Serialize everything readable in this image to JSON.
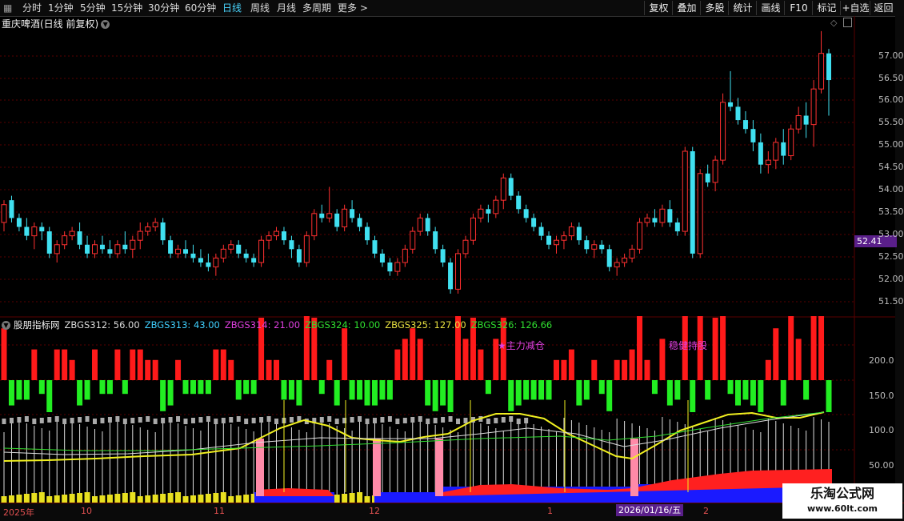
{
  "menubar": {
    "periods": [
      {
        "label": "分时"
      },
      {
        "label": "1分钟"
      },
      {
        "label": "5分钟"
      },
      {
        "label": "15分钟"
      },
      {
        "label": "30分钟"
      },
      {
        "label": "60分钟"
      },
      {
        "label": "日线",
        "active": true
      },
      {
        "label": "周线"
      },
      {
        "label": "月线"
      },
      {
        "label": "多周期"
      },
      {
        "label": "更多 >"
      }
    ],
    "buttons": [
      {
        "label": "复权"
      },
      {
        "label": "叠加"
      },
      {
        "label": "多股"
      },
      {
        "label": "统计"
      },
      {
        "label": "画线"
      },
      {
        "label": "F10"
      },
      {
        "label": "标记"
      },
      {
        "label": "+自选"
      },
      {
        "label": "返回"
      }
    ]
  },
  "chart": {
    "title": "重庆啤酒(日线 前复权)",
    "price_ticks": [
      "57.00",
      "56.50",
      "56.00",
      "55.50",
      "55.00",
      "54.50",
      "54.00",
      "53.50",
      "53.00",
      "52.50",
      "52.00",
      "51.50"
    ],
    "current_price": "52.41"
  },
  "indicator": {
    "name": "股朋指标网",
    "values": [
      {
        "text": "ZBGS312: 56.00",
        "color": "#dddddd"
      },
      {
        "text": "ZBGS313: 43.00",
        "color": "#40d0ff"
      },
      {
        "text": "ZBGS314: 21.00",
        "color": "#e040e0"
      },
      {
        "text": "ZBGS324: 10.00",
        "color": "#30e030"
      },
      {
        "text": "ZBGS325: 127.00",
        "color": "#e8e040"
      },
      {
        "text": "ZBGS326: 126.66",
        "color": "#30e030"
      }
    ],
    "ticks": [
      "200.0",
      "150.0",
      "100.0",
      "50.00"
    ],
    "annotations": [
      "★主力减仓",
      "稳健持股"
    ]
  },
  "dates": {
    "labels": [
      "2025年",
      "10",
      "11",
      "12",
      "1",
      "2"
    ],
    "cursor": "2026/01/16/五"
  },
  "watermark": {
    "line1": "乐淘公式网",
    "line2": "www.60lt.com"
  },
  "colors": {
    "up": "#ff3030",
    "down": "#40e0f0",
    "bg": "#000000",
    "grid": "#5a0000"
  },
  "chart_data": {
    "type": "candlestick",
    "y_range": [
      51.2,
      57.3
    ],
    "candles": [
      [
        52.9,
        53.4,
        52.7,
        53.3
      ],
      [
        53.4,
        53.5,
        52.9,
        53.0
      ],
      [
        53.0,
        53.1,
        52.7,
        52.8
      ],
      [
        52.8,
        53.0,
        52.5,
        52.6
      ],
      [
        52.6,
        52.9,
        52.3,
        52.8
      ],
      [
        52.8,
        52.9,
        52.5,
        52.7
      ],
      [
        52.7,
        52.8,
        52.1,
        52.2
      ],
      [
        52.2,
        52.5,
        52.0,
        52.4
      ],
      [
        52.4,
        52.7,
        52.3,
        52.6
      ],
      [
        52.6,
        52.8,
        52.5,
        52.7
      ],
      [
        52.7,
        52.9,
        52.3,
        52.4
      ],
      [
        52.4,
        52.6,
        52.1,
        52.2
      ],
      [
        52.2,
        52.5,
        52.1,
        52.4
      ],
      [
        52.4,
        52.6,
        52.2,
        52.3
      ],
      [
        52.3,
        52.5,
        52.1,
        52.2
      ],
      [
        52.2,
        52.5,
        52.1,
        52.4
      ],
      [
        52.4,
        52.7,
        52.2,
        52.3
      ],
      [
        52.3,
        52.6,
        52.1,
        52.5
      ],
      [
        52.5,
        52.9,
        52.3,
        52.7
      ],
      [
        52.7,
        52.9,
        52.6,
        52.8
      ],
      [
        52.8,
        53.0,
        52.7,
        52.9
      ],
      [
        52.9,
        53.0,
        52.4,
        52.5
      ],
      [
        52.5,
        52.6,
        52.1,
        52.2
      ],
      [
        52.2,
        52.4,
        52.1,
        52.3
      ],
      [
        52.3,
        52.5,
        52.1,
        52.2
      ],
      [
        52.2,
        52.4,
        52.0,
        52.1
      ],
      [
        52.1,
        52.3,
        51.9,
        52.0
      ],
      [
        52.0,
        52.2,
        51.8,
        51.9
      ],
      [
        51.9,
        52.2,
        51.7,
        52.1
      ],
      [
        52.1,
        52.4,
        52.0,
        52.3
      ],
      [
        52.3,
        52.5,
        52.2,
        52.4
      ],
      [
        52.4,
        52.5,
        52.1,
        52.2
      ],
      [
        52.2,
        52.3,
        52.0,
        52.1
      ],
      [
        52.1,
        52.2,
        51.9,
        52.0
      ],
      [
        52.0,
        52.6,
        51.9,
        52.5
      ],
      [
        52.5,
        52.7,
        52.3,
        52.6
      ],
      [
        52.6,
        52.8,
        52.5,
        52.7
      ],
      [
        52.7,
        52.8,
        52.4,
        52.5
      ],
      [
        52.5,
        52.6,
        52.1,
        52.3
      ],
      [
        52.3,
        52.4,
        51.9,
        52.0
      ],
      [
        52.0,
        52.7,
        51.9,
        52.6
      ],
      [
        52.6,
        53.2,
        52.5,
        53.1
      ],
      [
        53.1,
        53.3,
        52.9,
        53.0
      ],
      [
        53.0,
        53.7,
        52.9,
        53.1
      ],
      [
        53.1,
        53.2,
        52.7,
        52.8
      ],
      [
        52.8,
        53.3,
        52.7,
        53.2
      ],
      [
        53.2,
        53.4,
        52.9,
        53.0
      ],
      [
        53.0,
        53.1,
        52.7,
        52.8
      ],
      [
        52.8,
        52.9,
        52.4,
        52.5
      ],
      [
        52.5,
        52.6,
        52.1,
        52.2
      ],
      [
        52.2,
        52.3,
        51.9,
        52.0
      ],
      [
        52.0,
        52.1,
        51.7,
        51.8
      ],
      [
        51.8,
        52.1,
        51.7,
        52.0
      ],
      [
        52.0,
        52.4,
        51.9,
        52.3
      ],
      [
        52.3,
        52.8,
        52.2,
        52.7
      ],
      [
        52.7,
        53.1,
        52.6,
        53.0
      ],
      [
        53.0,
        53.1,
        52.6,
        52.7
      ],
      [
        52.7,
        52.8,
        52.2,
        52.3
      ],
      [
        52.3,
        52.4,
        51.9,
        52.0
      ],
      [
        52.0,
        52.1,
        51.3,
        51.4
      ],
      [
        51.4,
        52.3,
        51.3,
        52.2
      ],
      [
        52.2,
        52.6,
        52.1,
        52.5
      ],
      [
        52.5,
        53.1,
        52.4,
        53.0
      ],
      [
        53.0,
        53.3,
        52.9,
        53.2
      ],
      [
        53.2,
        53.3,
        52.9,
        53.1
      ],
      [
        53.1,
        53.5,
        53.0,
        53.4
      ],
      [
        53.4,
        54.0,
        53.2,
        53.9
      ],
      [
        53.9,
        54.0,
        53.4,
        53.5
      ],
      [
        53.5,
        53.6,
        53.1,
        53.2
      ],
      [
        53.2,
        53.3,
        52.9,
        53.0
      ],
      [
        53.0,
        53.1,
        52.7,
        52.8
      ],
      [
        52.8,
        52.9,
        52.5,
        52.6
      ],
      [
        52.6,
        52.7,
        52.3,
        52.4
      ],
      [
        52.4,
        52.6,
        52.2,
        52.5
      ],
      [
        52.5,
        52.7,
        52.3,
        52.6
      ],
      [
        52.6,
        52.9,
        52.5,
        52.8
      ],
      [
        52.8,
        52.9,
        52.4,
        52.5
      ],
      [
        52.5,
        52.6,
        52.2,
        52.3
      ],
      [
        52.3,
        52.5,
        52.1,
        52.4
      ],
      [
        52.4,
        52.5,
        52.2,
        52.3
      ],
      [
        52.3,
        52.4,
        51.8,
        51.9
      ],
      [
        51.9,
        52.1,
        51.7,
        52.0
      ],
      [
        52.0,
        52.2,
        51.9,
        52.1
      ],
      [
        52.1,
        52.4,
        52.0,
        52.3
      ],
      [
        52.3,
        53.0,
        52.2,
        52.9
      ],
      [
        52.9,
        53.1,
        52.8,
        53.0
      ],
      [
        53.0,
        53.2,
        52.8,
        52.9
      ],
      [
        52.9,
        53.3,
        52.8,
        53.2
      ],
      [
        53.2,
        53.4,
        52.8,
        52.9
      ],
      [
        52.9,
        53.0,
        52.6,
        52.7
      ],
      [
        52.7,
        54.6,
        52.6,
        54.5
      ],
      [
        54.5,
        54.6,
        52.1,
        52.2
      ],
      [
        52.2,
        54.1,
        52.1,
        54.0
      ],
      [
        54.0,
        54.2,
        53.7,
        53.8
      ],
      [
        53.8,
        54.4,
        53.6,
        54.3
      ],
      [
        54.3,
        55.8,
        54.2,
        55.6
      ],
      [
        55.6,
        56.3,
        55.4,
        55.5
      ],
      [
        55.5,
        55.7,
        55.1,
        55.2
      ],
      [
        55.2,
        55.4,
        54.9,
        55.0
      ],
      [
        55.0,
        55.2,
        54.5,
        54.7
      ],
      [
        54.7,
        54.9,
        54.0,
        54.2
      ],
      [
        54.2,
        54.5,
        54.0,
        54.3
      ],
      [
        54.3,
        54.8,
        54.1,
        54.7
      ],
      [
        54.7,
        55.0,
        54.2,
        54.4
      ],
      [
        54.4,
        55.1,
        54.3,
        55.0
      ],
      [
        55.0,
        55.5,
        54.9,
        55.3
      ],
      [
        55.3,
        55.6,
        54.8,
        55.1
      ],
      [
        55.1,
        56.1,
        54.6,
        55.9
      ],
      [
        55.9,
        57.2,
        55.8,
        56.7
      ],
      [
        56.7,
        56.8,
        55.3,
        56.1
      ]
    ]
  }
}
